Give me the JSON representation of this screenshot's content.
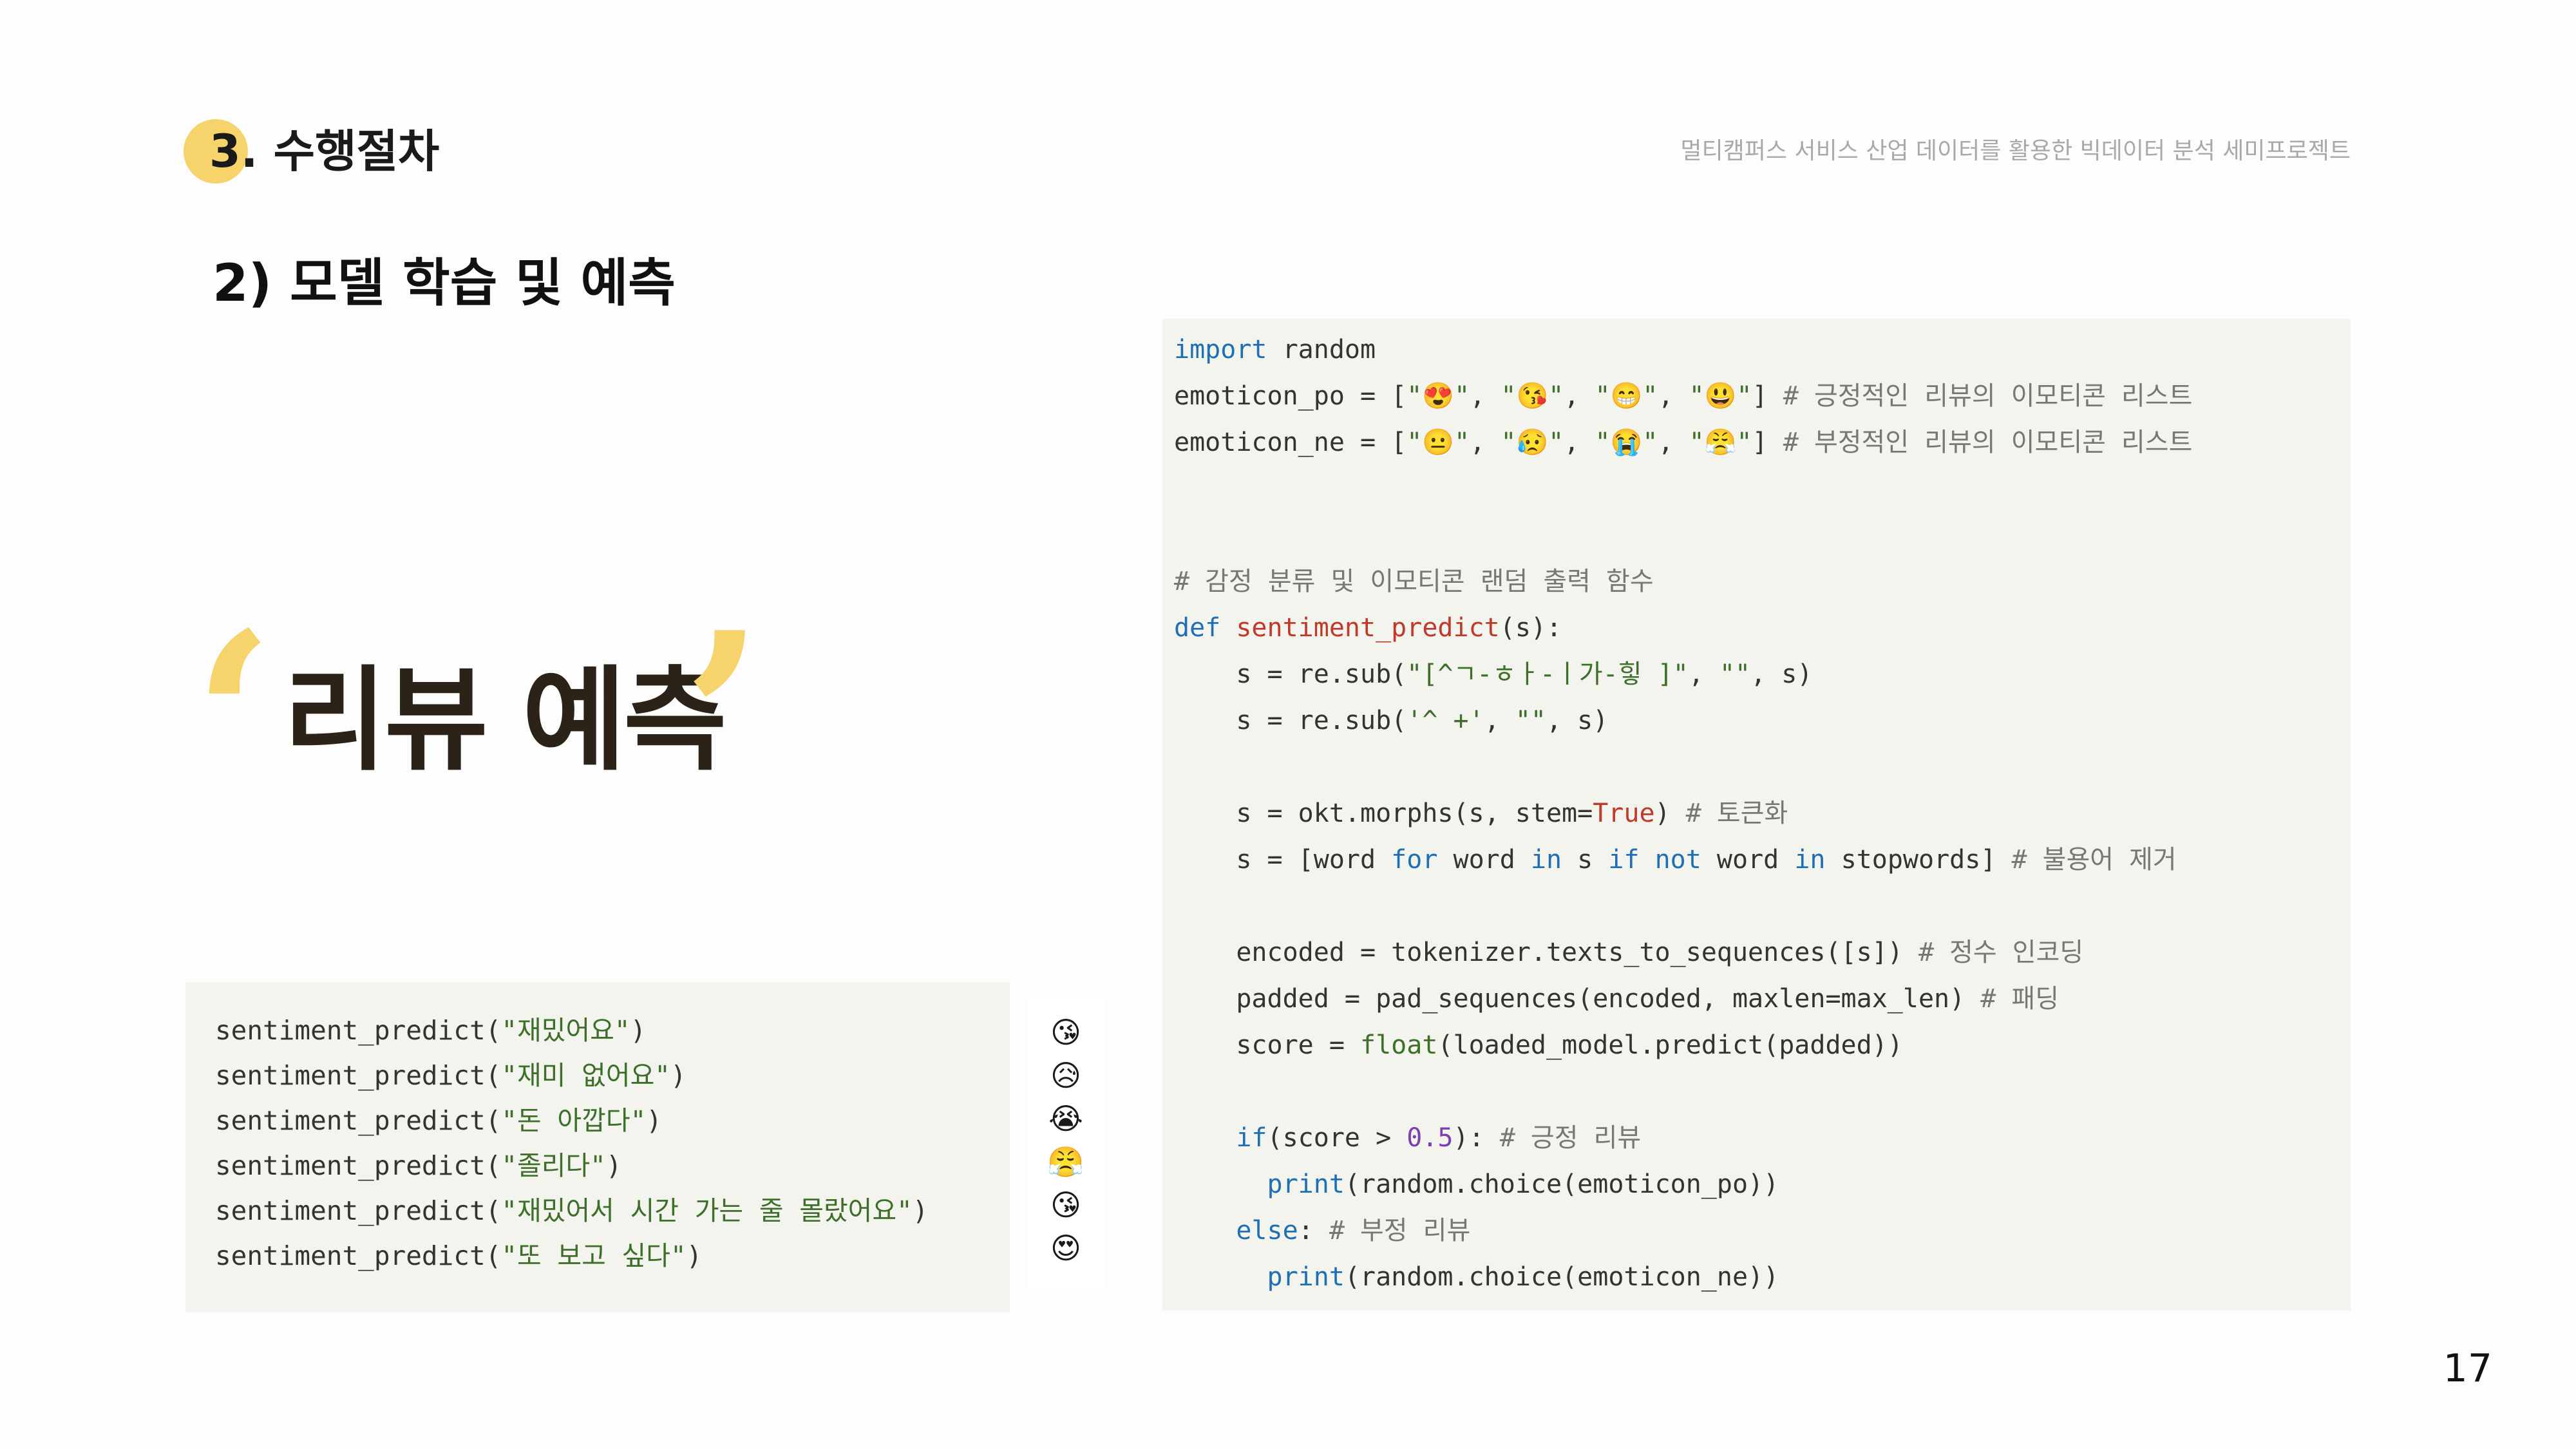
{
  "header": {
    "section_title": "3. 수행절차",
    "project_title": "멀티캠퍼스 서비스 산업 데이터를 활용한 빅데이터 분석 세미프로젝트"
  },
  "subtitle": "2) 모델 학습 및 예측",
  "big_title": "리뷰 예측",
  "calls": [
    {
      "fn": "sentiment_predict(",
      "arg": "\"재밌어요\"",
      "close": ")"
    },
    {
      "fn": "sentiment_predict(",
      "arg": "\"재미 없어요\"",
      "close": ")"
    },
    {
      "fn": "sentiment_predict(",
      "arg": "\"돈 아깝다\"",
      "close": ")"
    },
    {
      "fn": "sentiment_predict(",
      "arg": "\"졸리다\"",
      "close": ")"
    },
    {
      "fn": "sentiment_predict(",
      "arg": "\"재밌어서 시간 가는 줄 몰랐어요\"",
      "close": ")"
    },
    {
      "fn": "sentiment_predict(",
      "arg": "\"또 보고 싶다\"",
      "close": ")"
    }
  ],
  "outputs": [
    "😘",
    "😥",
    "😭",
    "😤",
    "😘",
    "😍"
  ],
  "code": [
    {
      "parts": [
        {
          "t": "import",
          "c": "kw"
        },
        {
          "t": " random",
          "c": ""
        }
      ]
    },
    {
      "parts": [
        {
          "t": "emoticon_po = [",
          "c": ""
        },
        {
          "t": "\"😍\"",
          "c": "str"
        },
        {
          "t": ", ",
          "c": ""
        },
        {
          "t": "\"😘\"",
          "c": "str"
        },
        {
          "t": ", ",
          "c": ""
        },
        {
          "t": "\"😁\"",
          "c": "str"
        },
        {
          "t": ", ",
          "c": ""
        },
        {
          "t": "\"😃\"",
          "c": "str"
        },
        {
          "t": "] ",
          "c": ""
        },
        {
          "t": "# 긍정적인 리뷰의 이모티콘 리스트",
          "c": "cmt"
        }
      ]
    },
    {
      "parts": [
        {
          "t": "emoticon_ne = [",
          "c": ""
        },
        {
          "t": "\"😐\"",
          "c": "str"
        },
        {
          "t": ", ",
          "c": ""
        },
        {
          "t": "\"😥\"",
          "c": "str"
        },
        {
          "t": ", ",
          "c": ""
        },
        {
          "t": "\"😭\"",
          "c": "str"
        },
        {
          "t": ", ",
          "c": ""
        },
        {
          "t": "\"😤\"",
          "c": "str"
        },
        {
          "t": "] ",
          "c": ""
        },
        {
          "t": "# 부정적인 리뷰의 이모티콘 리스트",
          "c": "cmt"
        }
      ]
    },
    {
      "parts": []
    },
    {
      "parts": []
    },
    {
      "parts": [
        {
          "t": "# 감정 분류 및 이모티콘 랜덤 출력 함수",
          "c": "cmt"
        }
      ]
    },
    {
      "parts": [
        {
          "t": "def",
          "c": "kw"
        },
        {
          "t": " ",
          "c": ""
        },
        {
          "t": "sentiment_predict",
          "c": "fn"
        },
        {
          "t": "(s):",
          "c": ""
        }
      ]
    },
    {
      "parts": [
        {
          "t": "    s = re.sub(",
          "c": ""
        },
        {
          "t": "\"[^ㄱ-ㅎㅏ-ㅣ가-힣 ]\"",
          "c": "str"
        },
        {
          "t": ", ",
          "c": ""
        },
        {
          "t": "\"\"",
          "c": "str"
        },
        {
          "t": ", s)",
          "c": ""
        }
      ]
    },
    {
      "parts": [
        {
          "t": "    s = re.sub(",
          "c": ""
        },
        {
          "t": "'^ +'",
          "c": "str"
        },
        {
          "t": ", ",
          "c": ""
        },
        {
          "t": "\"\"",
          "c": "str"
        },
        {
          "t": ", s)",
          "c": ""
        }
      ]
    },
    {
      "parts": []
    },
    {
      "parts": [
        {
          "t": "    s = okt.morphs(s, stem=",
          "c": ""
        },
        {
          "t": "True",
          "c": "fn"
        },
        {
          "t": ") ",
          "c": ""
        },
        {
          "t": "# 토큰화",
          "c": "cmt"
        }
      ]
    },
    {
      "parts": [
        {
          "t": "    s = [word ",
          "c": ""
        },
        {
          "t": "for",
          "c": "kw"
        },
        {
          "t": " word ",
          "c": ""
        },
        {
          "t": "in",
          "c": "kw"
        },
        {
          "t": " s ",
          "c": ""
        },
        {
          "t": "if not",
          "c": "kw"
        },
        {
          "t": " word ",
          "c": ""
        },
        {
          "t": "in",
          "c": "kw"
        },
        {
          "t": " stopwords] ",
          "c": ""
        },
        {
          "t": "# 불용어 제거",
          "c": "cmt"
        }
      ]
    },
    {
      "parts": []
    },
    {
      "parts": [
        {
          "t": "    encoded = tokenizer.texts_to_sequences([s]) ",
          "c": ""
        },
        {
          "t": "# 정수 인코딩",
          "c": "cmt"
        }
      ]
    },
    {
      "parts": [
        {
          "t": "    padded = pad_sequences(encoded, maxlen=max_len) ",
          "c": ""
        },
        {
          "t": "# 패딩",
          "c": "cmt"
        }
      ]
    },
    {
      "parts": [
        {
          "t": "    score = ",
          "c": ""
        },
        {
          "t": "float",
          "c": "str"
        },
        {
          "t": "(loaded_model.predict(padded))",
          "c": ""
        }
      ]
    },
    {
      "parts": []
    },
    {
      "parts": [
        {
          "t": "    ",
          "c": ""
        },
        {
          "t": "if",
          "c": "kw"
        },
        {
          "t": "(score > ",
          "c": ""
        },
        {
          "t": "0.5",
          "c": "num"
        },
        {
          "t": "): ",
          "c": ""
        },
        {
          "t": "# 긍정 리뷰",
          "c": "cmt"
        }
      ]
    },
    {
      "parts": [
        {
          "t": "      ",
          "c": ""
        },
        {
          "t": "print",
          "c": "kw"
        },
        {
          "t": "(random.choice(emoticon_po))",
          "c": ""
        }
      ]
    },
    {
      "parts": [
        {
          "t": "    ",
          "c": ""
        },
        {
          "t": "else",
          "c": "kw"
        },
        {
          "t": ": ",
          "c": ""
        },
        {
          "t": "# 부정 리뷰",
          "c": "cmt"
        }
      ]
    },
    {
      "parts": [
        {
          "t": "      ",
          "c": ""
        },
        {
          "t": "print",
          "c": "kw"
        },
        {
          "t": "(random.choice(emoticon_ne))",
          "c": ""
        }
      ]
    }
  ],
  "page_number": "17",
  "colors": {
    "accent": "#f6d36b",
    "code_bg": "#f4f4ef",
    "keyword": "#1f6fb5",
    "function": "#c0392b",
    "string": "#3d6f2a"
  }
}
